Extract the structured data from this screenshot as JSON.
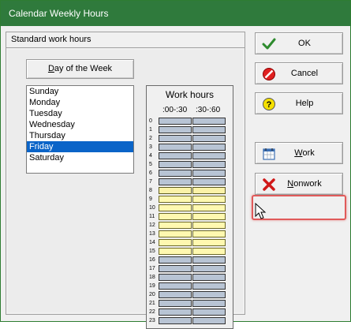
{
  "window": {
    "title": "Calendar Weekly Hours"
  },
  "panel": {
    "header": "Standard work hours"
  },
  "day_of_week": {
    "button_label": "Day of the Week",
    "days": [
      "Sunday",
      "Monday",
      "Tuesday",
      "Wednesday",
      "Thursday",
      "Friday",
      "Saturday"
    ],
    "selected": "Friday"
  },
  "work_hours": {
    "title": "Work hours",
    "col1": ":00-:30",
    "col2": ":30-:60",
    "hours": [
      "0",
      "1",
      "2",
      "3",
      "4",
      "5",
      "6",
      "7",
      "8",
      "9",
      "10",
      "11",
      "12",
      "13",
      "14",
      "15",
      "16",
      "17",
      "18",
      "19",
      "20",
      "21",
      "22",
      "23"
    ],
    "work_hours": [
      8,
      9,
      10,
      11,
      12,
      13,
      14,
      15
    ],
    "selected_hour": 8
  },
  "buttons": {
    "ok": "OK",
    "cancel": "Cancel",
    "help": "Help",
    "work": "Work",
    "nonwork": "Nonwork"
  },
  "colors": {
    "titlebar": "#2f7a3c",
    "nonwork_cell": "#b8c4d4",
    "work_cell": "#fff8b0",
    "selection": "#0a64c8",
    "highlight": "#e05a5a"
  }
}
